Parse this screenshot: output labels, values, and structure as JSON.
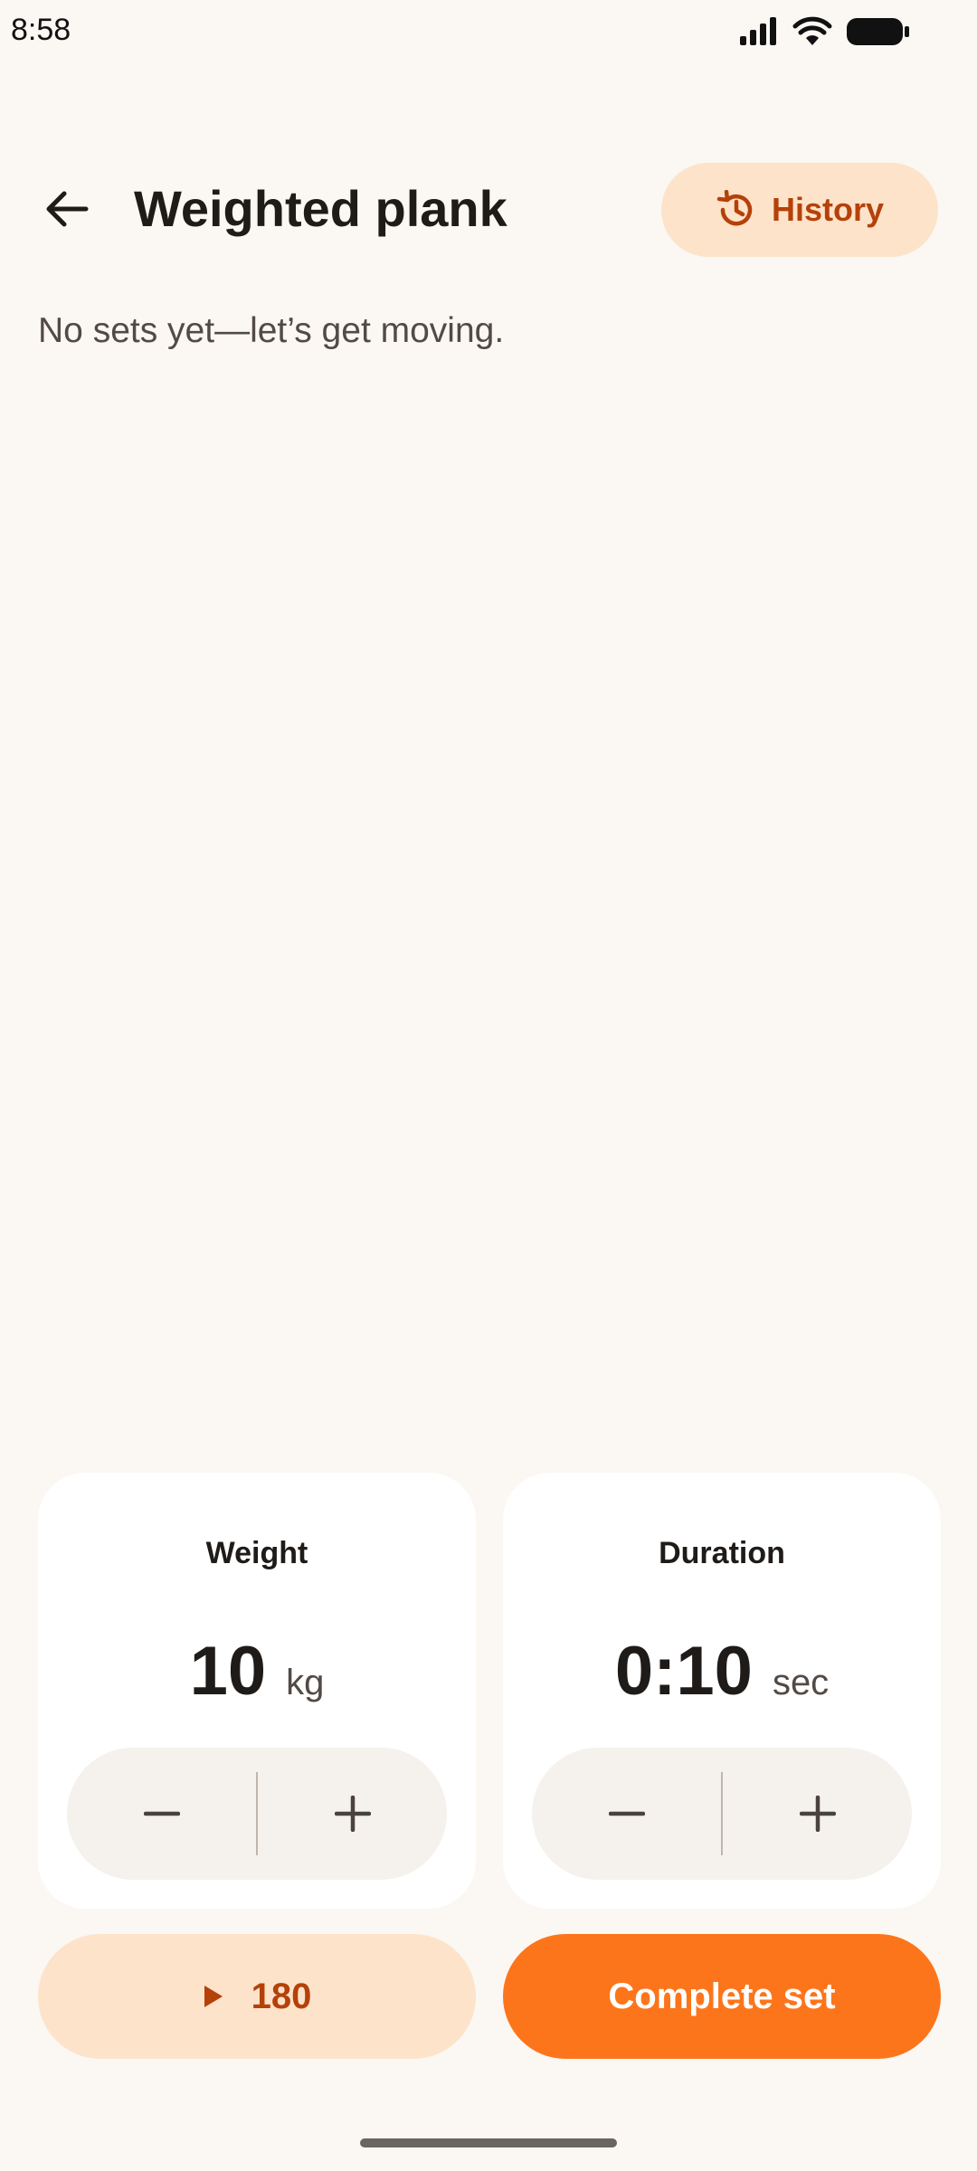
{
  "status_bar": {
    "time": "8:58"
  },
  "header": {
    "title": "Weighted plank",
    "history_label": "History"
  },
  "empty_message": "No sets yet—let’s get moving.",
  "weight_card": {
    "label": "Weight",
    "value": "10",
    "unit": "kg"
  },
  "duration_card": {
    "label": "Duration",
    "value": "0:10",
    "unit": "sec"
  },
  "actions": {
    "rest_timer_label": "180",
    "complete_set_label": "Complete set"
  },
  "colors": {
    "background": "#fbf7f3",
    "accent": "#fd751b",
    "accent_soft": "#fde3c9",
    "accent_text": "#b5410a"
  }
}
